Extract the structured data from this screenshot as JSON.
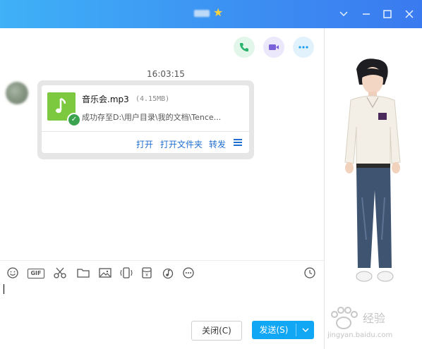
{
  "titlebar": {
    "controls": {
      "dropdown_icon": "chevron-down-icon",
      "minimize_icon": "minimize-icon",
      "maximize_icon": "maximize-icon",
      "close_icon": "close-icon"
    }
  },
  "header_actions": [
    {
      "name": "voice-call-button",
      "icon": "phone-icon",
      "color": "#29b36c",
      "bg": "#e2f6ea"
    },
    {
      "name": "video-call-button",
      "icon": "video-camera-icon",
      "color": "#7b61d9",
      "bg": "#ece8fb"
    },
    {
      "name": "more-button",
      "icon": "more-icon",
      "color": "#1aa0ef",
      "bg": "#e2f2fd"
    }
  ],
  "message": {
    "time": "16:03:15",
    "file": {
      "name": "音乐会.mp3",
      "size": "(4.15MB)",
      "status": "成功存至D:\\用户目录\\我的文档\\Tence...",
      "icon_color": "#7cc83f"
    },
    "actions": {
      "open": "打开",
      "open_folder": "打开文件夹",
      "forward": "转发"
    }
  },
  "toolbar": {
    "gif_label": "GIF",
    "icons": [
      "emoji-icon",
      "gif-icon",
      "scissors-icon",
      "folder-icon",
      "image-icon",
      "shake-icon",
      "red-packet-icon",
      "music-icon",
      "more-icon",
      "history-clock-icon"
    ]
  },
  "buttons": {
    "close_label": "关闭(C)",
    "send_label": "发送(S)",
    "send_color": "#12a7f5"
  },
  "watermark": {
    "text": "经验",
    "url": "jingyan.baidu.com"
  }
}
